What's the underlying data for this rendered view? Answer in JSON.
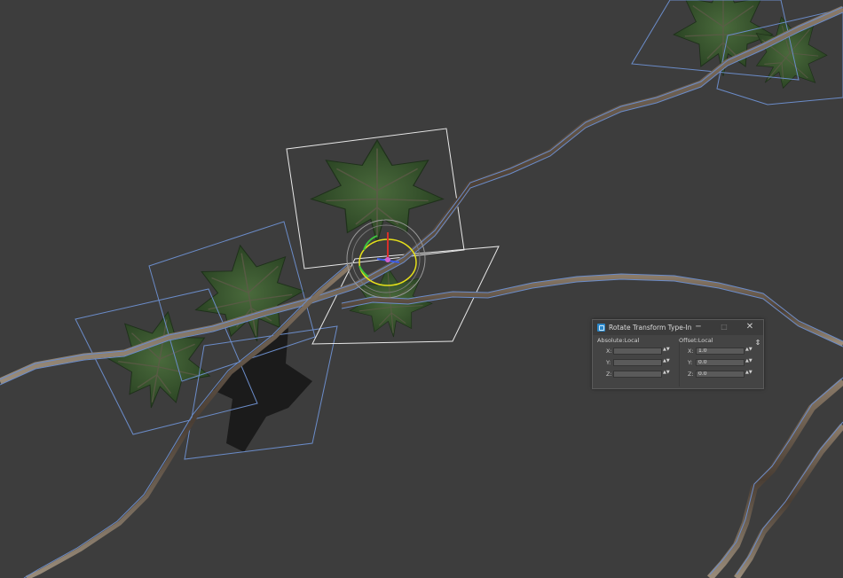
{
  "dialog": {
    "title": "Rotate Transform Type-In",
    "minimize_glyph": "─",
    "maximize_glyph": "□",
    "close_glyph": "✕",
    "absolute": {
      "label": "Absolute:Local",
      "x_label": "X:",
      "y_label": "Y:",
      "z_label": "Z:",
      "x_value": "",
      "y_value": "",
      "z_value": ""
    },
    "offset": {
      "label": "Offset:Local",
      "x_label": "X:",
      "y_label": "Y:",
      "z_label": "Z:",
      "x_value": "1.0",
      "y_value": "0.0",
      "z_value": "0.0"
    },
    "pin_glyph": "⇕",
    "spinner_glyph": "▲▼"
  },
  "colors": {
    "viewport_bg": "#3d3d3d",
    "wire_blue": "#6b8cc9",
    "selection_white": "#e8e8e8",
    "gizmo_yellow": "#e6e01a",
    "gizmo_red": "#d8302a",
    "gizmo_green": "#3ec43e",
    "gizmo_blue": "#3a5ae8",
    "leaf_green": "#2d4a26",
    "vine_brown": "#6a5a4a"
  }
}
